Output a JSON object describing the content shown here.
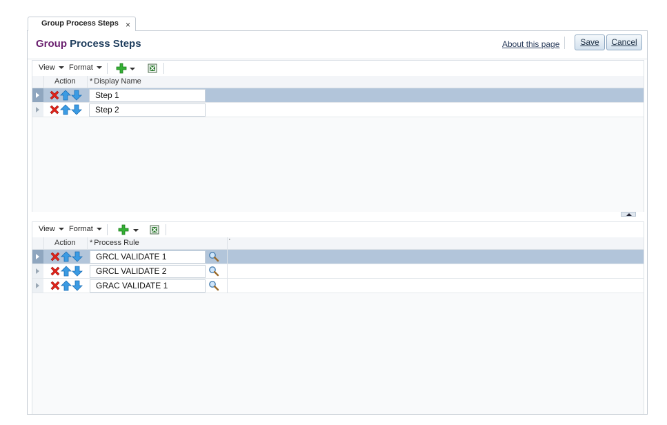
{
  "tab": {
    "label": "Group Process Steps",
    "close": "×"
  },
  "header": {
    "title_part1": "Group",
    "title_part2": "Process Steps",
    "about_link": "About this page",
    "save_label": "Save",
    "cancel_label": "Cancel"
  },
  "steps_table": {
    "toolbar": {
      "view": "View",
      "format": "Format"
    },
    "columns": {
      "action": "Action",
      "required_marker": "*",
      "display_name": "Display Name"
    },
    "rows": [
      {
        "display_name": "Step 1",
        "selected": true
      },
      {
        "display_name": "Step 2",
        "selected": false
      }
    ]
  },
  "rules_table": {
    "toolbar": {
      "view": "View",
      "format": "Format"
    },
    "columns": {
      "action": "Action",
      "required_marker": "*",
      "process_rule": "Process Rule",
      "extra": "·"
    },
    "rows": [
      {
        "process_rule": "GRCL VALIDATE 1",
        "selected": true
      },
      {
        "process_rule": "GRCL VALIDATE 2",
        "selected": false
      },
      {
        "process_rule": "GRAC VALIDATE 1",
        "selected": false
      }
    ]
  },
  "colors": {
    "title_purple": "#6a1f6e",
    "title_blue": "#1d3c5c",
    "selected_row": "#b2c5da",
    "delete_red": "#e2231a",
    "arrow_blue": "#2e8fd8",
    "add_green": "#2aa12a"
  },
  "icons": {
    "delete": "delete-icon",
    "move_up": "arrow-up-icon",
    "move_down": "arrow-down-icon",
    "add": "add-icon",
    "export": "export-excel-icon",
    "search": "search-icon"
  }
}
